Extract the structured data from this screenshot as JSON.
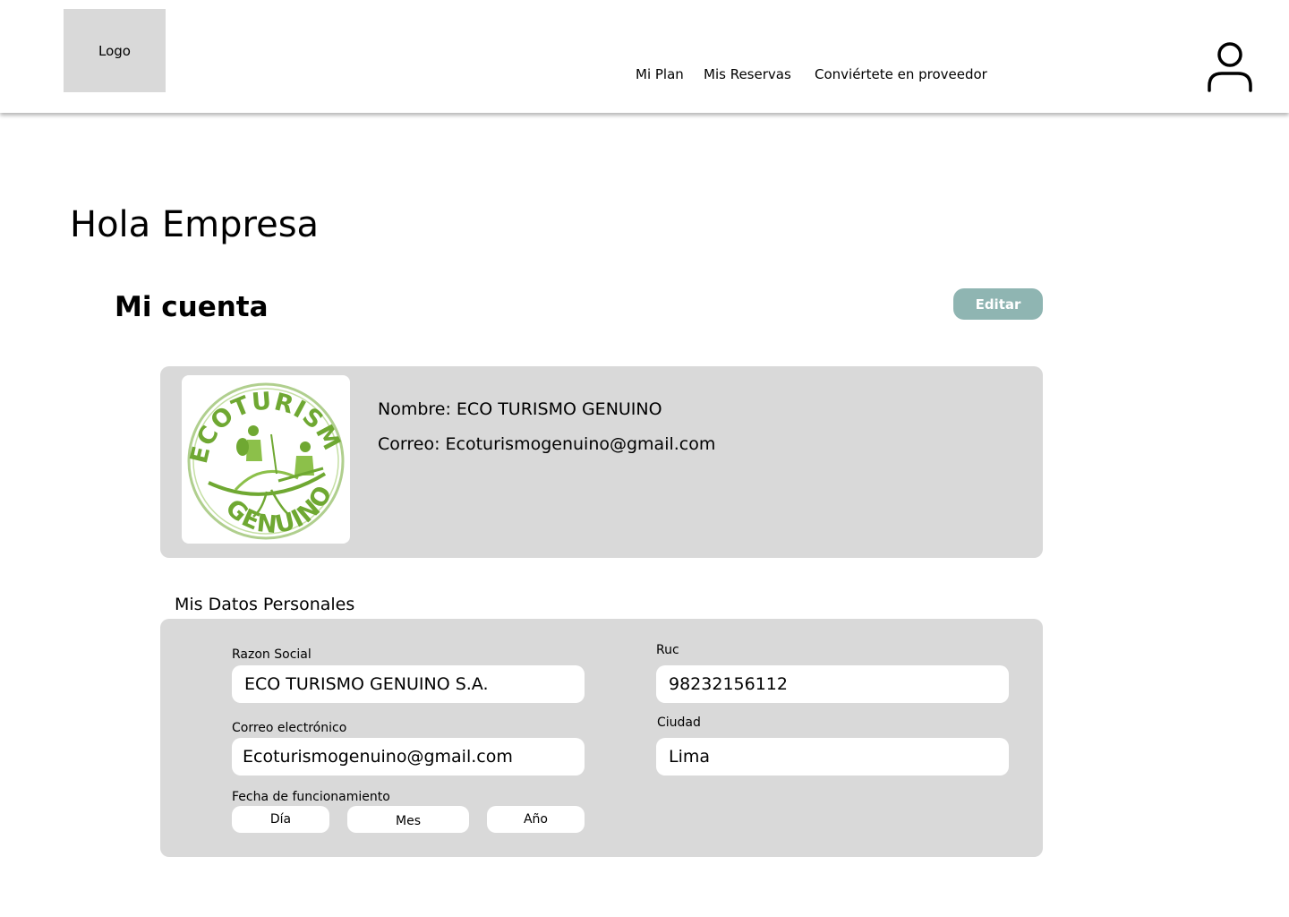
{
  "header": {
    "logo_label": "Logo",
    "nav": [
      "Mi Plan",
      "Mis Reservas",
      "Conviértete en proveedor"
    ],
    "user_icon": "user-icon"
  },
  "greeting": "Hola Empresa",
  "account": {
    "title": "Mi cuenta",
    "edit_label": "Editar",
    "logo_texts": [
      "ECOTURISMO",
      "GENUINO"
    ],
    "name_line": "Nombre: ECO TURISMO GENUINO",
    "email_line": "Correo: Ecoturismogenuino@gmail.com"
  },
  "personal_data": {
    "title": "Mis Datos Personales",
    "razon_social": {
      "label": "Razon Social",
      "value": "ECO TURISMO GENUINO S.A."
    },
    "ruc": {
      "label": "Ruc",
      "value": "98232156112"
    },
    "correo": {
      "label": "Correo electrónico",
      "value": "Ecoturismogenuino@gmail.com"
    },
    "ciudad": {
      "label": "Ciudad",
      "value": "Lima"
    },
    "fecha": {
      "label": "Fecha de funcionamiento",
      "dia": "Día",
      "mes": "Mes",
      "anio": "Año"
    }
  },
  "colors": {
    "edit_button": "#8fb5b2",
    "card_background": "#d9d9d9",
    "logo_green": "#6fa832"
  }
}
